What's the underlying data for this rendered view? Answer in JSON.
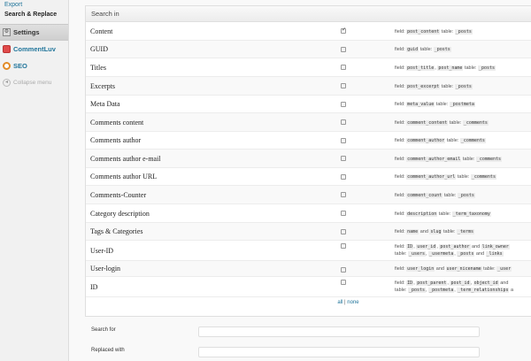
{
  "sidebar": {
    "sub_items": [
      {
        "label": "Export"
      },
      {
        "label": "Search & Replace"
      }
    ],
    "menu": [
      {
        "label": "Settings",
        "icon": "gear-icon"
      },
      {
        "label": "CommentLuv",
        "icon": "heart-icon"
      },
      {
        "label": "SEO",
        "icon": "seo-icon"
      },
      {
        "label": "Collapse menu",
        "icon": "collapse-icon"
      }
    ]
  },
  "search_in": {
    "title": "Search in",
    "rows": [
      {
        "label": "Content",
        "checked": true,
        "desc": [
          [
            "field: ",
            ""
          ],
          [
            "post_content",
            "c"
          ],
          [
            " table: ",
            ""
          ],
          [
            "_posts",
            "c"
          ]
        ]
      },
      {
        "label": "GUID",
        "checked": false,
        "desc": [
          [
            "field: ",
            ""
          ],
          [
            "guid",
            "c"
          ],
          [
            " table: ",
            ""
          ],
          [
            "_posts",
            "c"
          ]
        ]
      },
      {
        "label": "Titles",
        "checked": false,
        "desc": [
          [
            "field: ",
            ""
          ],
          [
            "post_title",
            "c"
          ],
          [
            ", ",
            ""
          ],
          [
            "post_name",
            "c"
          ],
          [
            " table: ",
            ""
          ],
          [
            "_posts",
            "c"
          ]
        ]
      },
      {
        "label": "Excerpts",
        "checked": false,
        "desc": [
          [
            "field: ",
            ""
          ],
          [
            "post_excerpt",
            "c"
          ],
          [
            " table: ",
            ""
          ],
          [
            "_posts",
            "c"
          ]
        ]
      },
      {
        "label": "Meta Data",
        "checked": false,
        "desc": [
          [
            "field: ",
            ""
          ],
          [
            "meta_value",
            "c"
          ],
          [
            " table: ",
            ""
          ],
          [
            "_postmeta",
            "c"
          ]
        ]
      },
      {
        "label": "Comments content",
        "checked": false,
        "desc": [
          [
            "field: ",
            ""
          ],
          [
            "comment_content",
            "c"
          ],
          [
            " table: ",
            ""
          ],
          [
            "_comments",
            "c"
          ]
        ]
      },
      {
        "label": "Comments author",
        "checked": false,
        "desc": [
          [
            "field: ",
            ""
          ],
          [
            "comment_author",
            "c"
          ],
          [
            " table: ",
            ""
          ],
          [
            "_comments",
            "c"
          ]
        ]
      },
      {
        "label": "Comments author e-mail",
        "checked": false,
        "desc": [
          [
            "field: ",
            ""
          ],
          [
            "comment_author_email",
            "c"
          ],
          [
            " table: ",
            ""
          ],
          [
            "_comments",
            "c"
          ]
        ]
      },
      {
        "label": "Comments author URL",
        "checked": false,
        "desc": [
          [
            "field: ",
            ""
          ],
          [
            "comment_author_url",
            "c"
          ],
          [
            " table: ",
            ""
          ],
          [
            "_comments",
            "c"
          ]
        ]
      },
      {
        "label": "Comments-Counter",
        "checked": false,
        "desc": [
          [
            "field: ",
            ""
          ],
          [
            "comment_count",
            "c"
          ],
          [
            " table: ",
            ""
          ],
          [
            "_posts",
            "c"
          ]
        ]
      },
      {
        "label": "Category description",
        "checked": false,
        "desc": [
          [
            "field: ",
            ""
          ],
          [
            "description",
            "c"
          ],
          [
            " table: ",
            ""
          ],
          [
            "_term_taxonomy",
            "c"
          ]
        ]
      },
      {
        "label": "Tags & Categories",
        "checked": false,
        "desc": [
          [
            "field: ",
            ""
          ],
          [
            "name",
            "c"
          ],
          [
            " and ",
            ""
          ],
          [
            "slug",
            "c"
          ],
          [
            " table: ",
            ""
          ],
          [
            "_terms",
            "c"
          ]
        ]
      },
      {
        "label": "User-ID",
        "checked": false,
        "desc": [
          [
            "field: ",
            ""
          ],
          [
            "ID",
            "c"
          ],
          [
            ", ",
            ""
          ],
          [
            "user_id",
            "c"
          ],
          [
            ", ",
            ""
          ],
          [
            "post_author",
            "c"
          ],
          [
            " and ",
            ""
          ],
          [
            "link_owner",
            "c"
          ],
          [
            "\n",
            ""
          ],
          [
            "table: ",
            ""
          ],
          [
            "_users",
            "c"
          ],
          [
            ", ",
            ""
          ],
          [
            "_usermeta",
            "c"
          ],
          [
            ", ",
            ""
          ],
          [
            "_posts",
            "c"
          ],
          [
            " and ",
            ""
          ],
          [
            "_links",
            "c"
          ]
        ]
      },
      {
        "label": "User-login",
        "checked": false,
        "desc": [
          [
            "field: ",
            ""
          ],
          [
            "user_login",
            "c"
          ],
          [
            " and ",
            ""
          ],
          [
            "user_nicename",
            "c"
          ],
          [
            " table: ",
            ""
          ],
          [
            "_user",
            "c"
          ]
        ]
      },
      {
        "label": "ID",
        "checked": false,
        "desc": [
          [
            "field: ",
            ""
          ],
          [
            "ID",
            "c"
          ],
          [
            ", ",
            ""
          ],
          [
            "post_parent",
            "c"
          ],
          [
            ", ",
            ""
          ],
          [
            "post_id",
            "c"
          ],
          [
            ", ",
            ""
          ],
          [
            "object_id",
            "c"
          ],
          [
            " and",
            ""
          ],
          [
            "\n",
            ""
          ],
          [
            "table: ",
            ""
          ],
          [
            "_posts",
            "c"
          ],
          [
            ", ",
            ""
          ],
          [
            "_postmeta",
            "c"
          ],
          [
            ", ",
            ""
          ],
          [
            "_term_relationships",
            "c"
          ],
          [
            " a",
            ""
          ]
        ]
      }
    ],
    "all_label": "all",
    "separator": "|",
    "none_label": "none"
  },
  "form": {
    "search_for_label": "Search for",
    "search_for_value": "",
    "replaced_with_label": "Replaced with",
    "replaced_with_value": ""
  }
}
